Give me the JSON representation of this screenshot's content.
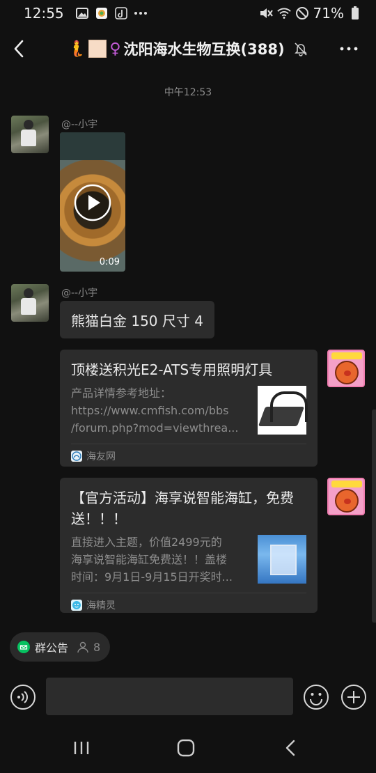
{
  "status_bar": {
    "time": "12:55",
    "battery": "71%"
  },
  "header": {
    "title": "沈阳海水生物互换(388)",
    "title_emoji": "🧜",
    "gender_symbol": "♀"
  },
  "chat": {
    "timestamp": "中午12:53",
    "messages": [
      {
        "sender": "@--小宇",
        "type": "video",
        "duration": "0:09"
      },
      {
        "sender": "@--小宇",
        "type": "text",
        "text": "熊猫白金 150  尺寸 4"
      },
      {
        "type": "link-card",
        "title": "顶楼送积光E2-ATS专用照明灯具",
        "desc_lines": [
          "产品详情参考地址：",
          "https://www.cmfish.com/bbs",
          "/forum.php?mod=viewthrea..."
        ],
        "source": "海友网"
      },
      {
        "type": "link-card",
        "title": "【官方活动】海享说智能海缸，免费送！！！",
        "desc_lines": [
          "直接进入主题，价值2499元的",
          "海享说智能海缸免费送！！盖楼",
          "时间：9月1日-9月15日开奖时..."
        ],
        "source": "海精灵"
      }
    ]
  },
  "bottom": {
    "notice_label": "群公告",
    "member_count": "8",
    "input_placeholder": ""
  },
  "colors": {
    "background": "#111111",
    "bubble": "#2c2c2c",
    "accent_green": "#07c160"
  }
}
